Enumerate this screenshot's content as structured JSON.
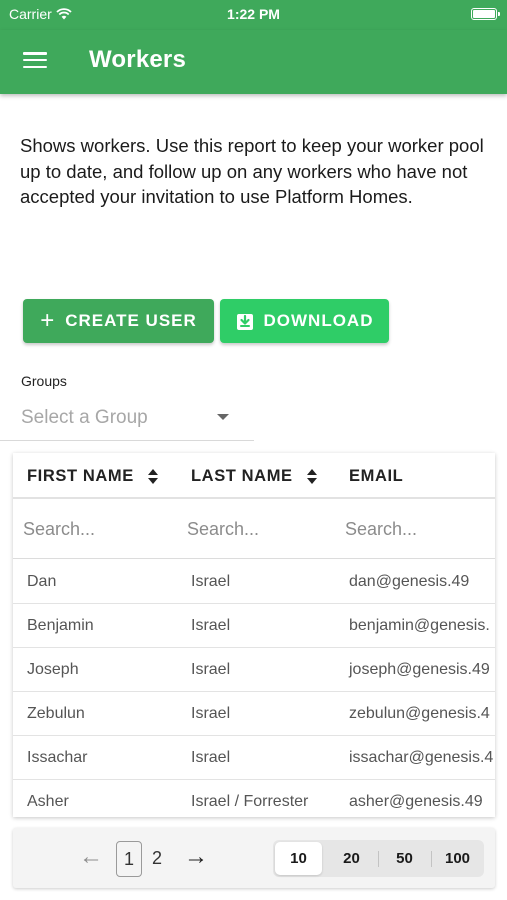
{
  "status_bar": {
    "carrier": "Carrier",
    "time": "1:22 PM"
  },
  "app_bar": {
    "title": "Workers",
    "menu_icon": "hamburger-menu-icon"
  },
  "description": "Shows workers. Use this report to keep your worker pool up to date, and follow up on any workers who have not accepted your invitation to use Platform Homes.",
  "actions": {
    "create_user_label": "CREATE USER",
    "download_label": "DOWNLOAD"
  },
  "groups": {
    "label": "Groups",
    "placeholder": "Select a Group"
  },
  "table": {
    "columns": [
      "FIRST NAME",
      "LAST NAME",
      "EMAIL"
    ],
    "search_placeholder": "Search...",
    "rows": [
      {
        "first": "Dan",
        "last": "Israel",
        "email": "dan@genesis.49"
      },
      {
        "first": "Benjamin",
        "last": "Israel",
        "email": "benjamin@genesis."
      },
      {
        "first": "Joseph",
        "last": "Israel",
        "email": "joseph@genesis.49"
      },
      {
        "first": "Zebulun",
        "last": "Israel",
        "email": "zebulun@genesis.4"
      },
      {
        "first": "Issachar",
        "last": "Israel",
        "email": "issachar@genesis.4"
      },
      {
        "first": "Asher",
        "last": "Israel / Forrester",
        "email": "asher@genesis.49"
      }
    ]
  },
  "pagination": {
    "pages": [
      "1",
      "2"
    ],
    "current_page": "1",
    "page_sizes": [
      "10",
      "20",
      "50",
      "100"
    ],
    "selected_page_size": "10"
  },
  "colors": {
    "primary": "#3fa95b",
    "download_button": "#2fcd67"
  }
}
